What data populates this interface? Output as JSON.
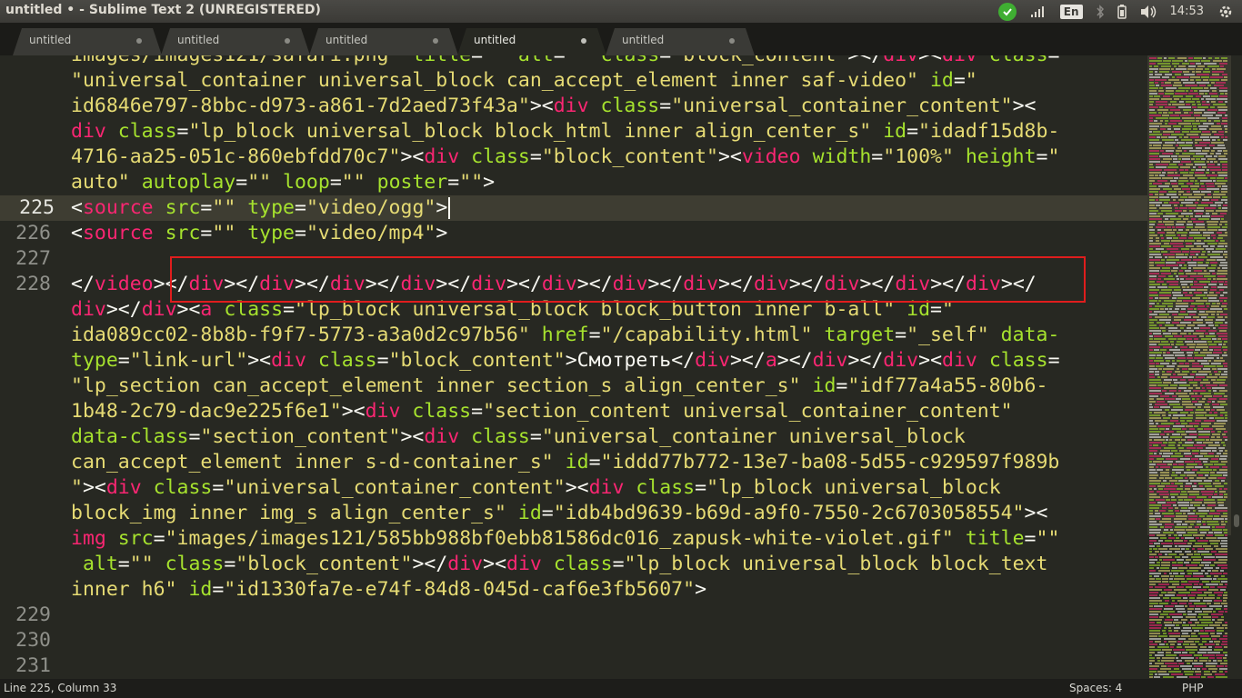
{
  "window": {
    "title": "untitled • - Sublime Text 2 (UNREGISTERED)"
  },
  "tray": {
    "language": "En",
    "clock": "14:53",
    "icons": [
      "checkmark-icon",
      "signal-icon",
      "keyboard-layout-icon",
      "bluetooth-icon",
      "battery-icon",
      "volume-icon",
      "gear-icon"
    ]
  },
  "tabs": [
    {
      "label": "untitled",
      "active": false
    },
    {
      "label": "untitled",
      "active": false
    },
    {
      "label": "untitled",
      "active": false
    },
    {
      "label": "untitled",
      "active": true
    },
    {
      "label": "untitled",
      "active": false
    }
  ],
  "editor": {
    "line_numbers": {
      "n225": "225",
      "n226": "226",
      "n227": "227",
      "n228": "228",
      "n229": "229",
      "n230": "230",
      "n231": "231"
    },
    "current_line": "225",
    "colors": {
      "tag": "#f92672",
      "attribute": "#a6e22e",
      "string": "#e6db74",
      "text": "#f8f8f2",
      "background": "#272822",
      "highlight_box": "#e01d1d"
    }
  },
  "status": {
    "position": "Line 225, Column 33",
    "spaces": "Spaces: 4",
    "syntax": "PHP"
  }
}
